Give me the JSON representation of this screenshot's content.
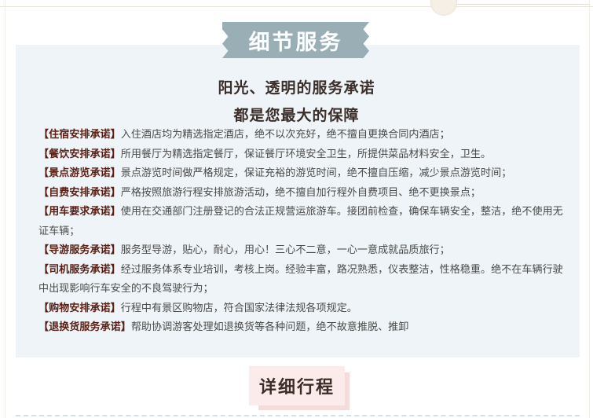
{
  "section_title": "细节服务",
  "headline_line1": "阳光、透明的服务承诺",
  "headline_line2": "都是您最大的保障",
  "terms": [
    {
      "label": "【住宿安排承诺】",
      "text": "入住酒店均为精选指定酒店，绝不以次充好，绝不擅自更换合同内酒店；"
    },
    {
      "label": "【餐饮安排承诺】",
      "text": "所用餐厅为精选指定餐厅，保证餐厅环境安全卫生，所提供菜品材料安全，卫生。"
    },
    {
      "label": "【景点游览承诺】",
      "text": "景点游览时间做严格规定，保证充裕的游览时间，绝不擅自压缩，减少景点游览时间；"
    },
    {
      "label": "【自费安排承诺】",
      "text": "严格按照旅游行程安排旅游活动，绝不擅自加行程外自费项目、绝不更换景点；"
    },
    {
      "label": "【用车要求承诺】",
      "text": "使用在交通部门注册登记的合法正规营运旅游车。接团前检查，确保车辆安全，整洁，绝不使用无证车辆；"
    },
    {
      "label": "【导游服务承诺】",
      "text": "服务型导游，贴心，耐心，用心！三心不二意，一心一意成就品质旅行；"
    },
    {
      "label": "【司机服务承诺】",
      "text": "经过服务体系专业培训，考核上岗。经验丰富，路况熟悉，仪表整洁，性格稳重。绝不在车辆行驶中出现影响行车安全的不良驾驶行为；"
    },
    {
      "label": "【购物安排承诺】",
      "text": "行程中有景区购物店，符合国家法律法规各项规定。"
    },
    {
      "label": "【退换货服务承诺】",
      "text": "帮助协调游客处理如退换货等各种问题，绝不故意推脱、推卸"
    }
  ],
  "next_section_title": "详细行程",
  "colors": {
    "ribbon": "#9aaeb5",
    "panel": "#eef4f7",
    "label": "#5a1f14",
    "itinerary_bg": "#fbeceb"
  }
}
